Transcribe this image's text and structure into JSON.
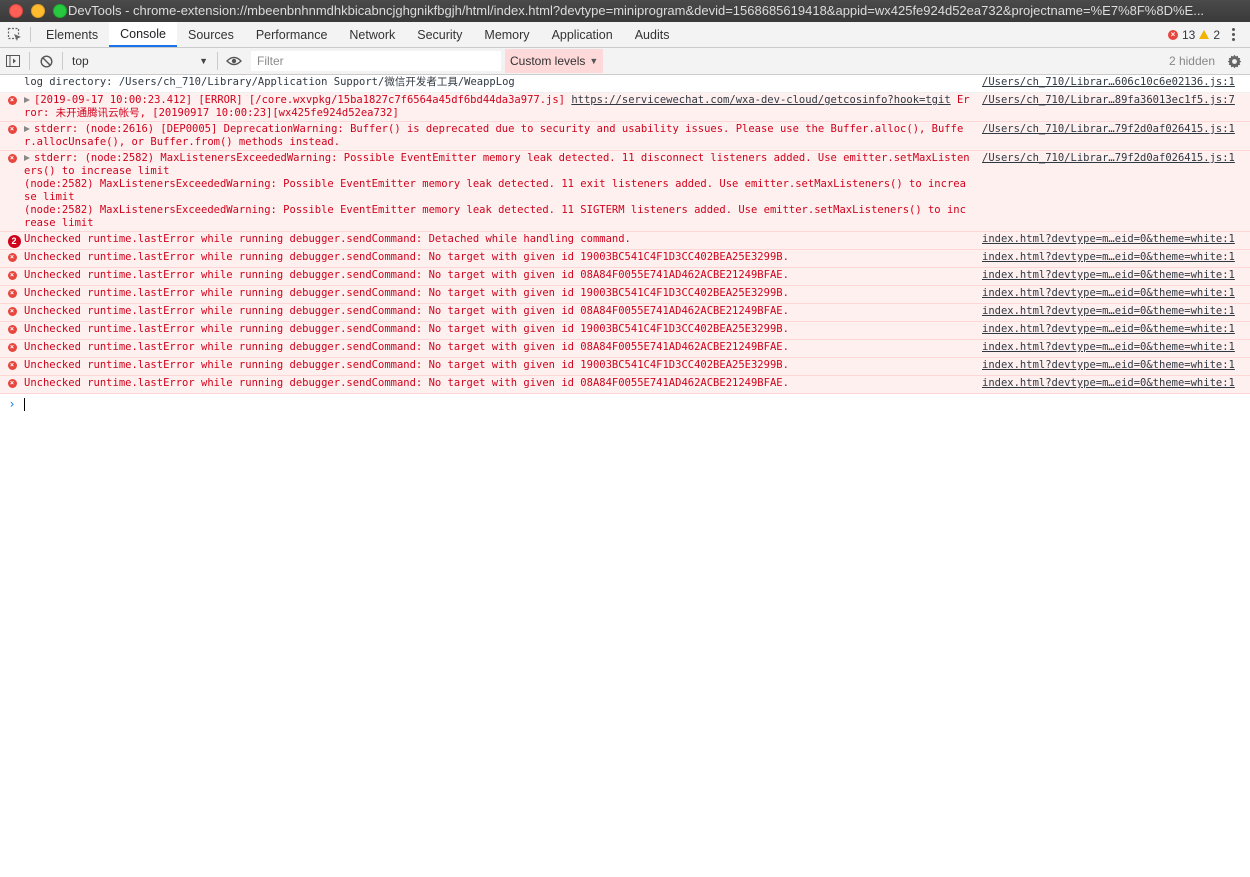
{
  "window": {
    "title": "DevTools - chrome-extension://mbeenbnhnmdhkbicabncjghgnikfbgjh/html/index.html?devtype=miniprogram&devid=1568685619418&appid=wx425fe924d52ea732&projectname=%E7%8F%8D%E..."
  },
  "tabs": [
    {
      "label": "Elements"
    },
    {
      "label": "Console"
    },
    {
      "label": "Sources"
    },
    {
      "label": "Performance"
    },
    {
      "label": "Network"
    },
    {
      "label": "Security"
    },
    {
      "label": "Memory"
    },
    {
      "label": "Application"
    },
    {
      "label": "Audits"
    }
  ],
  "active_tab": "Console",
  "counters": {
    "errors": "13",
    "warnings": "2"
  },
  "toolbar": {
    "context": "top",
    "filter_placeholder": "Filter",
    "levels_label": "Custom levels",
    "hidden": "2 hidden"
  },
  "messages": {
    "m0": {
      "text": "log directory: /Users/ch_710/Library/Application Support/微信开发者工具/WeappLog",
      "source": "/Users/ch_710/Librar…606c10c6e02136.js:1"
    },
    "m1": {
      "pre": "[2019-09-17 10:00:23.412] [ERROR] [/core.wxvpkg/15ba1827c7f6564a45df6bd44da3a977.js] ",
      "link": "https://servicewechat.com/wxa-dev-cloud/getcosinfo?hook=tgit",
      "post": " Error: 未开通腾讯云帐号, [20190917 10:00:23][wx425fe924d52ea732]",
      "source": "/Users/ch_710/Librar…89fa36013ec1f5.js:7"
    },
    "m2": {
      "text": "stderr: (node:2616) [DEP0005] DeprecationWarning: Buffer() is deprecated due to security and usability issues. Please use the Buffer.alloc(), Buffer.allocUnsafe(), or Buffer.from() methods instead.",
      "source": "/Users/ch_710/Librar…79f2d0af026415.js:1"
    },
    "m3": {
      "text": "stderr: (node:2582) MaxListenersExceededWarning: Possible EventEmitter memory leak detected. 11 disconnect listeners added. Use emitter.setMaxListeners() to increase limit\n(node:2582) MaxListenersExceededWarning: Possible EventEmitter memory leak detected. 11 exit listeners added. Use emitter.setMaxListeners() to increase limit\n(node:2582) MaxListenersExceededWarning: Possible EventEmitter memory leak detected. 11 SIGTERM listeners added. Use emitter.setMaxListeners() to increase limit",
      "source": "/Users/ch_710/Librar…79f2d0af026415.js:1"
    },
    "m4": {
      "count": "2",
      "text": "Unchecked runtime.lastError while running debugger.sendCommand: Detached while handling command.",
      "source": "index.html?devtype=m…eid=0&theme=white:1"
    },
    "m5": {
      "text": "Unchecked runtime.lastError while running debugger.sendCommand: No target with given id 19003BC541C4F1D3CC402BEA25E3299B.",
      "source": "index.html?devtype=m…eid=0&theme=white:1"
    },
    "m6": {
      "text": "Unchecked runtime.lastError while running debugger.sendCommand: No target with given id 08A84F0055E741AD462ACBE21249BFAE.",
      "source": "index.html?devtype=m…eid=0&theme=white:1"
    },
    "m7": {
      "text": "Unchecked runtime.lastError while running debugger.sendCommand: No target with given id 19003BC541C4F1D3CC402BEA25E3299B.",
      "source": "index.html?devtype=m…eid=0&theme=white:1"
    },
    "m8": {
      "text": "Unchecked runtime.lastError while running debugger.sendCommand: No target with given id 08A84F0055E741AD462ACBE21249BFAE.",
      "source": "index.html?devtype=m…eid=0&theme=white:1"
    },
    "m9": {
      "text": "Unchecked runtime.lastError while running debugger.sendCommand: No target with given id 19003BC541C4F1D3CC402BEA25E3299B.",
      "source": "index.html?devtype=m…eid=0&theme=white:1"
    },
    "m10": {
      "text": "Unchecked runtime.lastError while running debugger.sendCommand: No target with given id 08A84F0055E741AD462ACBE21249BFAE.",
      "source": "index.html?devtype=m…eid=0&theme=white:1"
    },
    "m11": {
      "text": "Unchecked runtime.lastError while running debugger.sendCommand: No target with given id 19003BC541C4F1D3CC402BEA25E3299B.",
      "source": "index.html?devtype=m…eid=0&theme=white:1"
    },
    "m12": {
      "text": "Unchecked runtime.lastError while running debugger.sendCommand: No target with given id 08A84F0055E741AD462ACBE21249BFAE.",
      "source": "index.html?devtype=m…eid=0&theme=white:1"
    }
  },
  "colors": {
    "error_text": "#d0021b",
    "error_bg": "#fff0f0",
    "accent": "#1a73e8"
  },
  "icons": [
    "inspect-icon",
    "sidebar-toggle-icon",
    "clear-console-icon",
    "eye-icon",
    "gear-icon",
    "kebab-menu-icon",
    "error-icon",
    "warning-icon",
    "expand-triangle-icon",
    "prompt-chevron-icon"
  ]
}
